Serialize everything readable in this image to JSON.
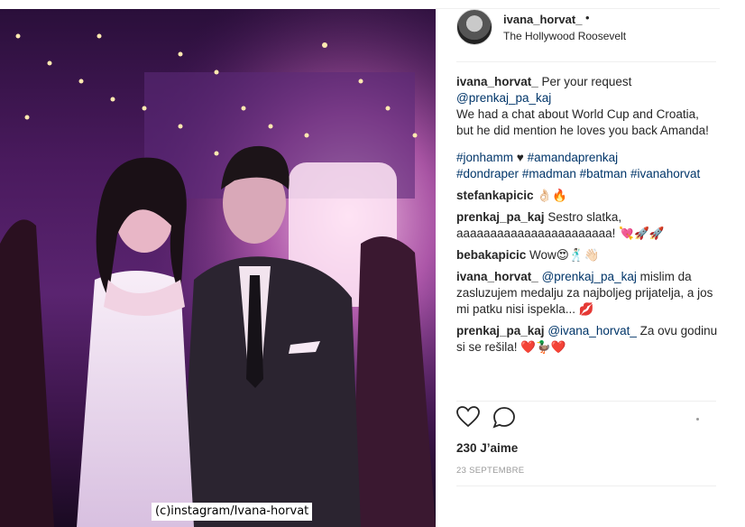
{
  "post": {
    "username": "ivana_horvat_",
    "follow_dot": "•",
    "location": "The Hollywood Roosevelt",
    "watermark": "(c)instagram/Ivana-horvat",
    "likes": "230 J’aime",
    "date": "23 SEPTEMBRE"
  },
  "caption": {
    "user": "ivana_horvat_",
    "text1": " Per your request ",
    "mention": "@prenkaj_pa_kaj",
    "text2": "We had a chat about World Cup and Croatia, but he did mention he loves you back Amanda!",
    "tag1": "#jonhamm",
    "heart": " ♥ ",
    "tag2": "#amandaprenkaj",
    "tag3": "#dondraper",
    "tag4": "#madman",
    "tag5": "#batman",
    "tag6": "#ivanahorvat"
  },
  "comments": [
    {
      "user": "stefankapicic",
      "text": " 👌🏻🔥"
    },
    {
      "user": "prenkaj_pa_kaj",
      "text": " Sestro slatka, aaaaaaaaaaaaaaaaaaaaaaa! 💘🚀🚀"
    },
    {
      "user": "bebakapicic",
      "text": " Wow😍🕺🏻👋🏻"
    },
    {
      "user": "ivana_horvat_",
      "mention": "@prenkaj_pa_kaj",
      "text": " mislim da zasluzujem medalju za najboljeg prijatelja, a jos mi patku nisi ispekla... 💋"
    },
    {
      "user": "prenkaj_pa_kaj",
      "mention": "@ivana_horvat_",
      "text": " Za ovu godinu si se rešila! ❤️🦆❤️"
    }
  ],
  "icons": {
    "like": "heart-icon",
    "comment": "comment-bubble-icon"
  },
  "colors": {
    "link": "#003569",
    "text": "#262626",
    "muted": "#999999"
  }
}
